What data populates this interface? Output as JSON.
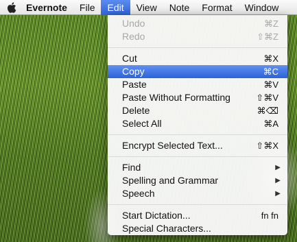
{
  "menubar": {
    "apple_icon": "apple-logo-icon",
    "app_name": "Evernote",
    "items": [
      "File",
      "Edit",
      "View",
      "Note",
      "Format",
      "Window"
    ],
    "active_item": "Edit"
  },
  "menu": {
    "groups": [
      [
        {
          "label": "Undo",
          "shortcut": "⌘Z",
          "enabled": false
        },
        {
          "label": "Redo",
          "shortcut": "⇧⌘Z",
          "enabled": false
        }
      ],
      [
        {
          "label": "Cut",
          "shortcut": "⌘X",
          "enabled": true
        },
        {
          "label": "Copy",
          "shortcut": "⌘C",
          "enabled": true,
          "highlighted": true
        },
        {
          "label": "Paste",
          "shortcut": "⌘V",
          "enabled": true
        },
        {
          "label": "Paste Without Formatting",
          "shortcut": "⇧⌘V",
          "enabled": true
        },
        {
          "label": "Delete",
          "shortcut": "⌘⌫",
          "enabled": true
        },
        {
          "label": "Select All",
          "shortcut": "⌘A",
          "enabled": true
        }
      ],
      [
        {
          "label": "Encrypt Selected Text...",
          "shortcut": "⇧⌘X",
          "enabled": true
        }
      ],
      [
        {
          "label": "Find",
          "submenu": true,
          "enabled": true
        },
        {
          "label": "Spelling and Grammar",
          "submenu": true,
          "enabled": true
        },
        {
          "label": "Speech",
          "submenu": true,
          "enabled": true
        }
      ],
      [
        {
          "label": "Start Dictation...",
          "shortcut": "fn fn",
          "enabled": true
        },
        {
          "label": "Special Characters...",
          "enabled": true
        }
      ]
    ]
  },
  "colors": {
    "highlight": "#2f63d8",
    "disabled_text": "#a8a8a8"
  }
}
